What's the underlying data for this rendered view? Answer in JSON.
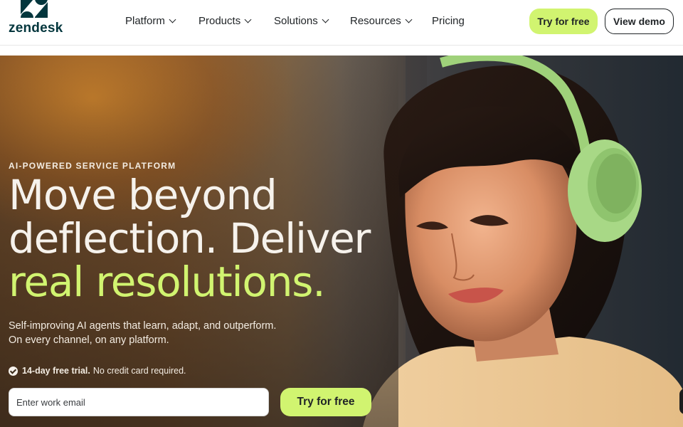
{
  "header": {
    "logo_text": "zendesk",
    "nav": [
      {
        "label": "Platform",
        "has_dropdown": true
      },
      {
        "label": "Products",
        "has_dropdown": true
      },
      {
        "label": "Solutions",
        "has_dropdown": true
      },
      {
        "label": "Resources",
        "has_dropdown": true
      },
      {
        "label": "Pricing",
        "has_dropdown": false
      }
    ],
    "try_label": "Try for free",
    "demo_label": "View demo"
  },
  "hero": {
    "eyebrow": "AI-POWERED SERVICE PLATFORM",
    "headline_line1": "Move beyond",
    "headline_line2": "deflection. Deliver",
    "headline_accent": "real resolutions.",
    "sub_line1": "Self-improving AI agents that learn, adapt, and outperform.",
    "sub_line2": "On every channel, on any platform.",
    "trial_bold": "14-day free trial.",
    "trial_rest": "No credit card required.",
    "email_placeholder": "Enter work email",
    "cta_label": "Try for free"
  },
  "colors": {
    "accent": "#d1f470",
    "ink": "#1f2326",
    "brand": "#03363d"
  },
  "icons": [
    "zendesk-logo-icon",
    "chevron-down-icon",
    "check-circle-icon"
  ]
}
